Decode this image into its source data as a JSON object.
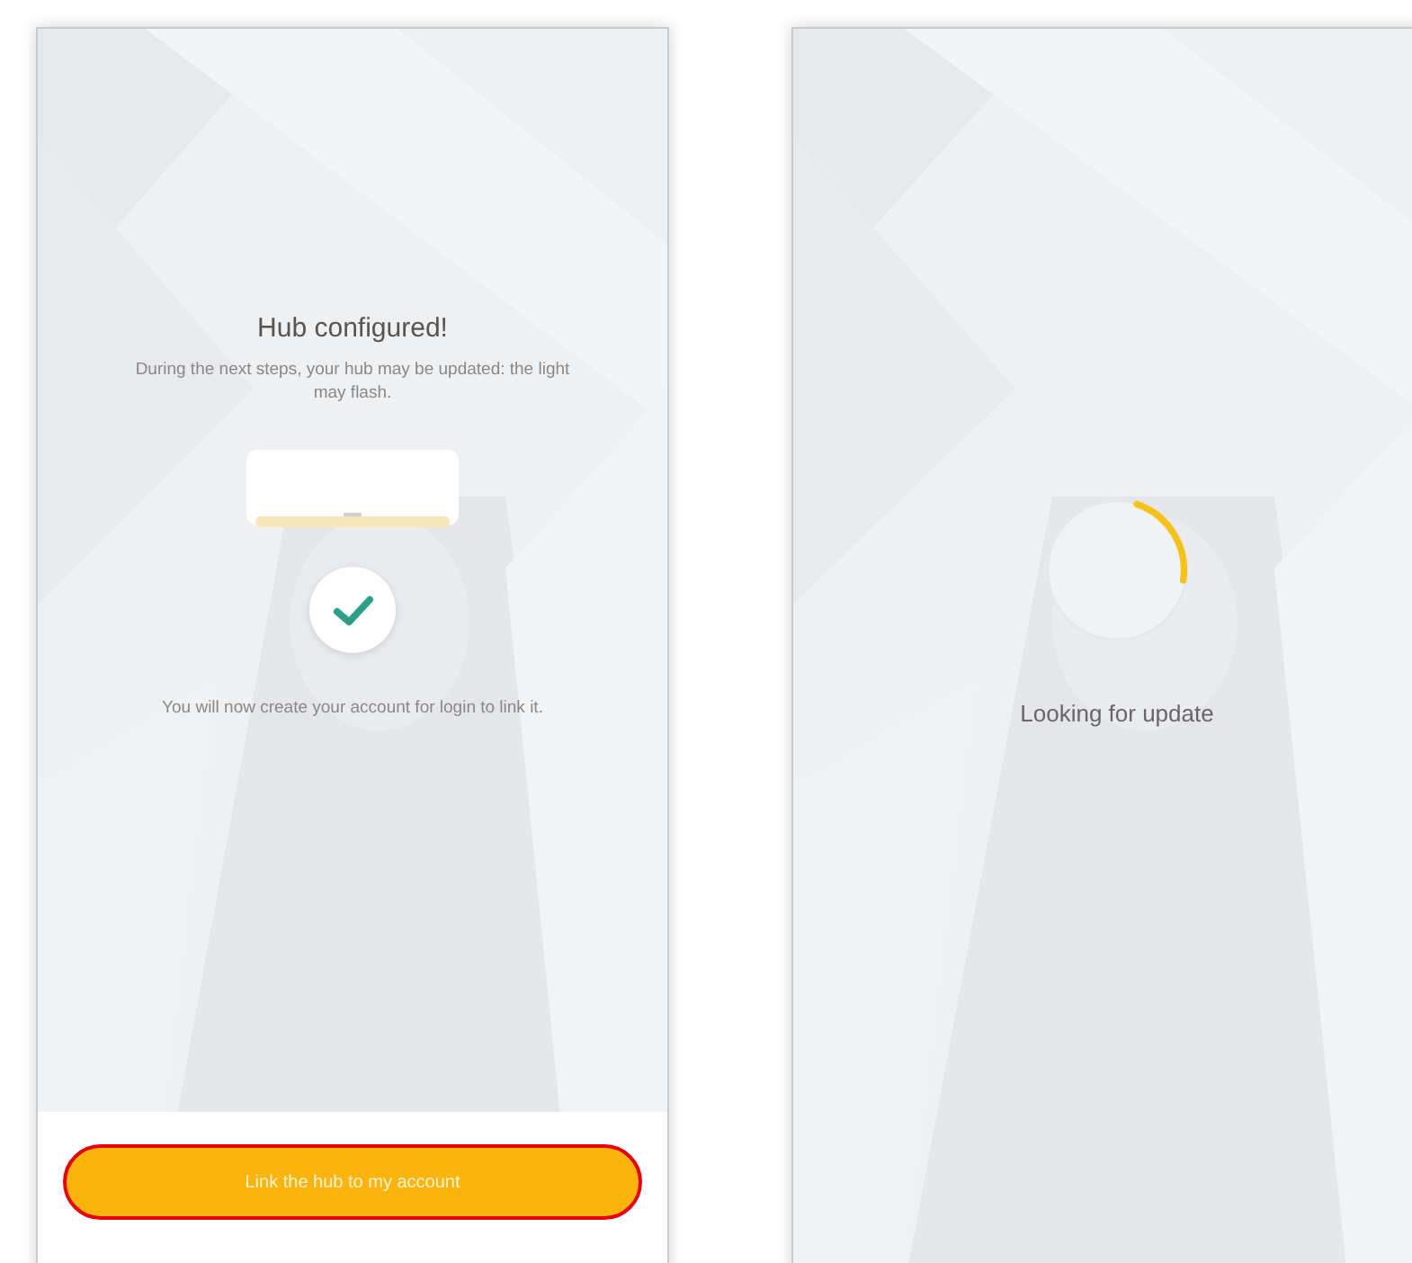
{
  "screens": [
    {
      "kind": "configured",
      "title": "Hub configured!",
      "description": "During the next steps, your hub may be updated: the light may flash.",
      "note": "You will now create your account for login to link it.",
      "button": {
        "label": "Link the hub to my account",
        "highlighted": true
      }
    },
    {
      "kind": "updating",
      "status": "Looking for update"
    }
  ]
}
